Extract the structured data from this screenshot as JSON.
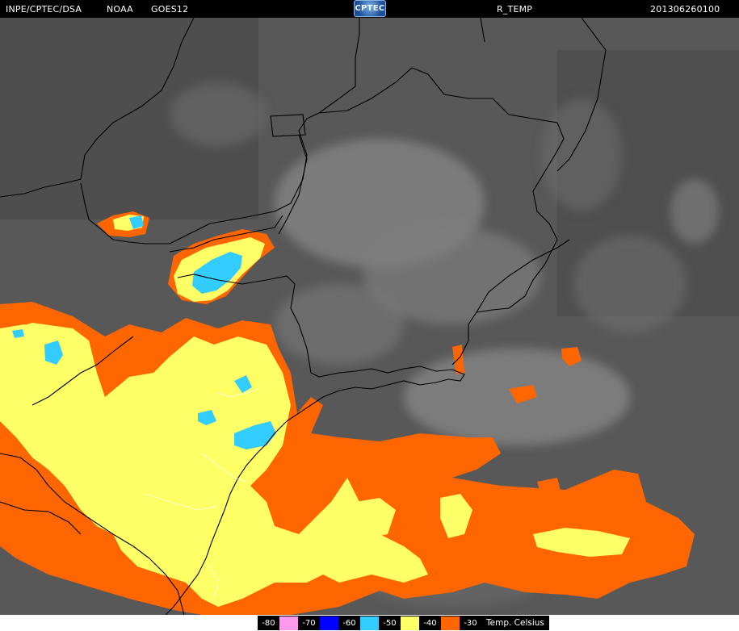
{
  "header": {
    "agency": "INPE/CPTEC/DSA",
    "source": "NOAA",
    "satellite": "GOES12",
    "logo_text": "CPTEC",
    "product": "R_TEMP",
    "timestamp": "201306260100"
  },
  "map": {
    "background_color": "#5a5a5a",
    "border_color": "#000000",
    "coastline_color": "#000000"
  },
  "legend": {
    "unit": "Temp. Celsius",
    "items": [
      {
        "label": "-80",
        "color": "#ff99ee"
      },
      {
        "label": "-70",
        "color": "#0000ff"
      },
      {
        "label": "-60",
        "color": "#33ccff"
      },
      {
        "label": "-50",
        "color": "#ffff66"
      },
      {
        "label": "-40",
        "color": "#ff6600"
      },
      {
        "label": "-30",
        "color": "#000000"
      }
    ]
  }
}
